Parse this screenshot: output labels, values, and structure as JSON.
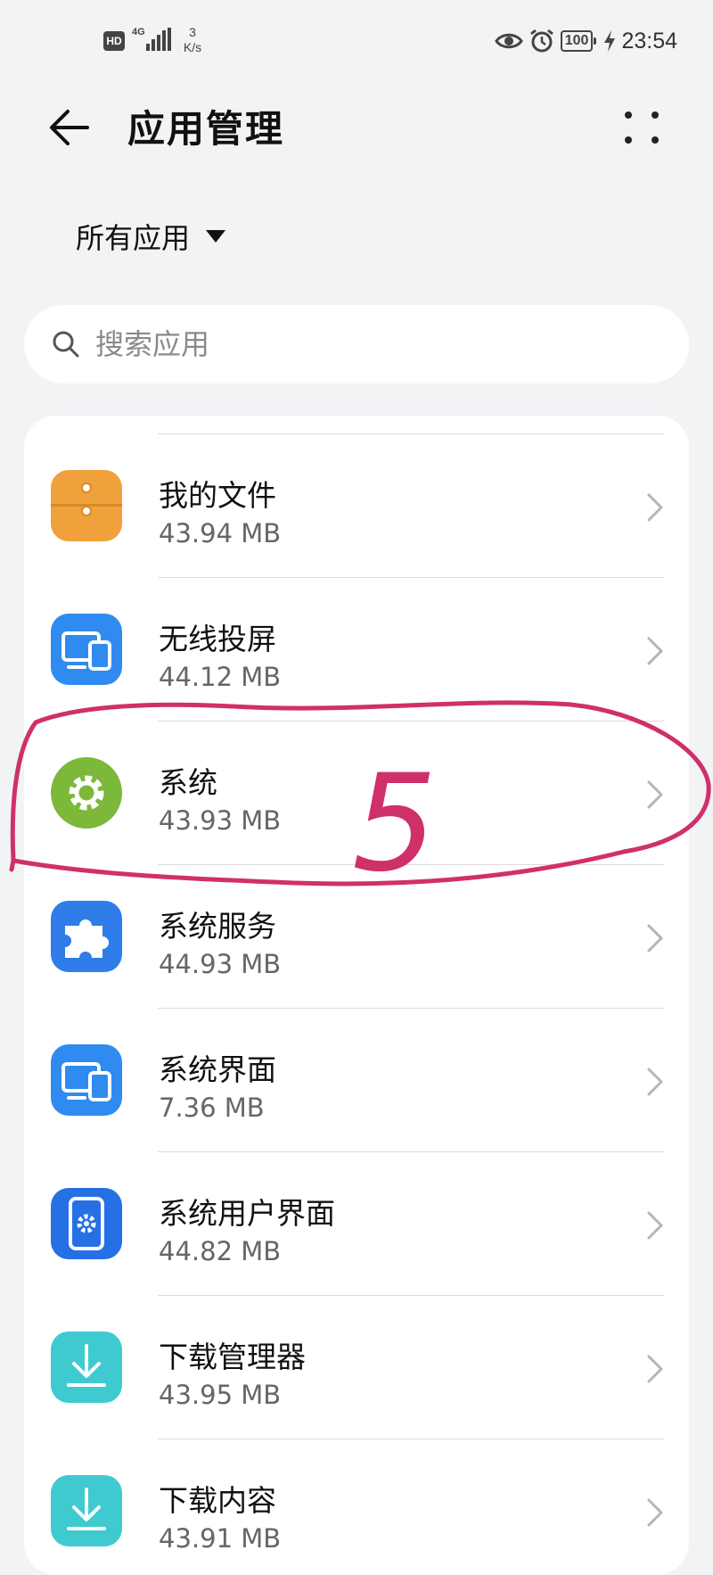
{
  "status_bar": {
    "hd": "HD",
    "network": "4G",
    "speed_value": "3",
    "speed_unit": "K/s",
    "battery": "100",
    "time": "23:54"
  },
  "header": {
    "title": "应用管理"
  },
  "filter": {
    "label": "所有应用"
  },
  "search": {
    "placeholder": "搜索应用"
  },
  "apps": [
    {
      "name": "我的文件",
      "size": "43.94 MB",
      "icon": "folder-icon",
      "color": "#f0a13c"
    },
    {
      "name": "无线投屏",
      "size": "44.12 MB",
      "icon": "screen-cast-icon",
      "color": "#2f8bef"
    },
    {
      "name": "系统",
      "size": "43.93 MB",
      "icon": "gear-icon",
      "color": "#7cb83a"
    },
    {
      "name": "系统服务",
      "size": "44.93 MB",
      "icon": "puzzle-icon",
      "color": "#2f7de8"
    },
    {
      "name": "系统界面",
      "size": "7.36 MB",
      "icon": "screen-cast-icon",
      "color": "#2f8bef"
    },
    {
      "name": "系统用户界面",
      "size": "44.82 MB",
      "icon": "phone-gear-icon",
      "color": "#2670e6"
    },
    {
      "name": "下载管理器",
      "size": "43.95 MB",
      "icon": "download-icon",
      "color": "#3fcad0"
    },
    {
      "name": "下载内容",
      "size": "43.91 MB",
      "icon": "download-icon",
      "color": "#3fcad0"
    }
  ],
  "annotation": {
    "mark": "5",
    "color": "#d0306a"
  }
}
